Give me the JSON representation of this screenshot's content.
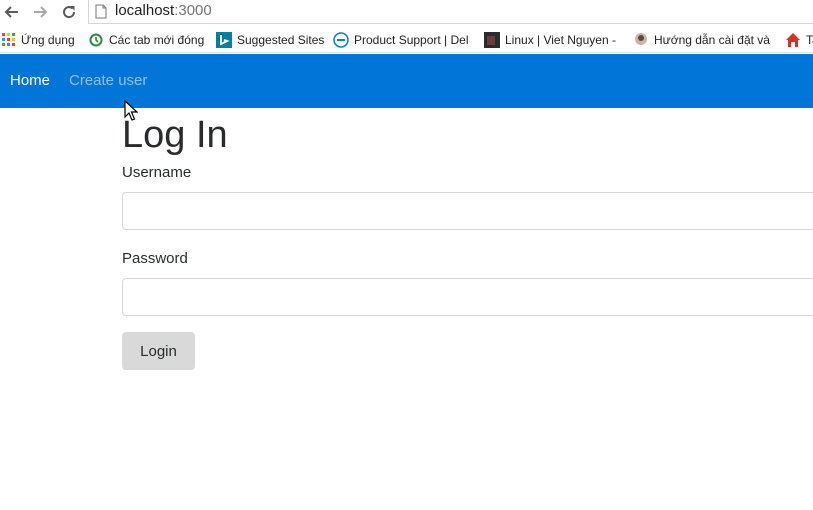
{
  "browser": {
    "url_host": "localhost",
    "url_port": ":3000",
    "bookmarks": [
      {
        "label": "Ứng dụng",
        "icon": "apps-grid-icon"
      },
      {
        "label": "Các tab mới đóng",
        "icon": "history-icon"
      },
      {
        "label": "Suggested Sites",
        "icon": "bing-icon"
      },
      {
        "label": "Product Support | Del",
        "icon": "dell-icon"
      },
      {
        "label": "Linux | Viet Nguyen -",
        "icon": "thumbnail-icon"
      },
      {
        "label": "Hướng dẫn cài đặt và",
        "icon": "avatar-icon"
      },
      {
        "label": "Ta",
        "icon": "home-icon"
      }
    ]
  },
  "navbar": {
    "home": "Home",
    "create_user": "Create user",
    "background": "#0275d8"
  },
  "form": {
    "title": "Log In",
    "username_label": "Username",
    "username_value": "",
    "password_label": "Password",
    "password_value": "",
    "submit_label": "Login"
  }
}
